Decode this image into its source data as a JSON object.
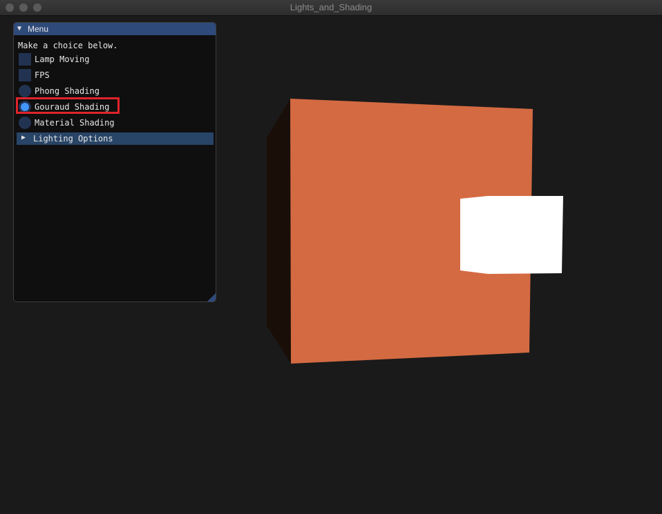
{
  "window": {
    "title": "Lights_and_Shading"
  },
  "menu": {
    "title": "Menu",
    "instruction": "Make a choice below.",
    "checkboxes": [
      {
        "label": "Lamp Moving",
        "checked": false
      },
      {
        "label": "FPS",
        "checked": false
      }
    ],
    "radios": [
      {
        "label": "Phong Shading",
        "selected": false
      },
      {
        "label": "Gouraud Shading",
        "selected": true
      },
      {
        "label": "Material Shading",
        "selected": false
      }
    ],
    "collapsible": {
      "label": "Lighting Options",
      "expanded": false
    }
  },
  "colors": {
    "background": "#1a1a1a",
    "panel_header": "#2e4a7a",
    "accent": "#4296fa",
    "cube_front": "#d46a42",
    "cube_side": "#1a0e08",
    "lamp": "#ffffff",
    "highlight": "#e0242a"
  },
  "icons": {
    "header_arrow": "triangle-down-icon",
    "collapsible_arrow": "triangle-right-icon"
  }
}
